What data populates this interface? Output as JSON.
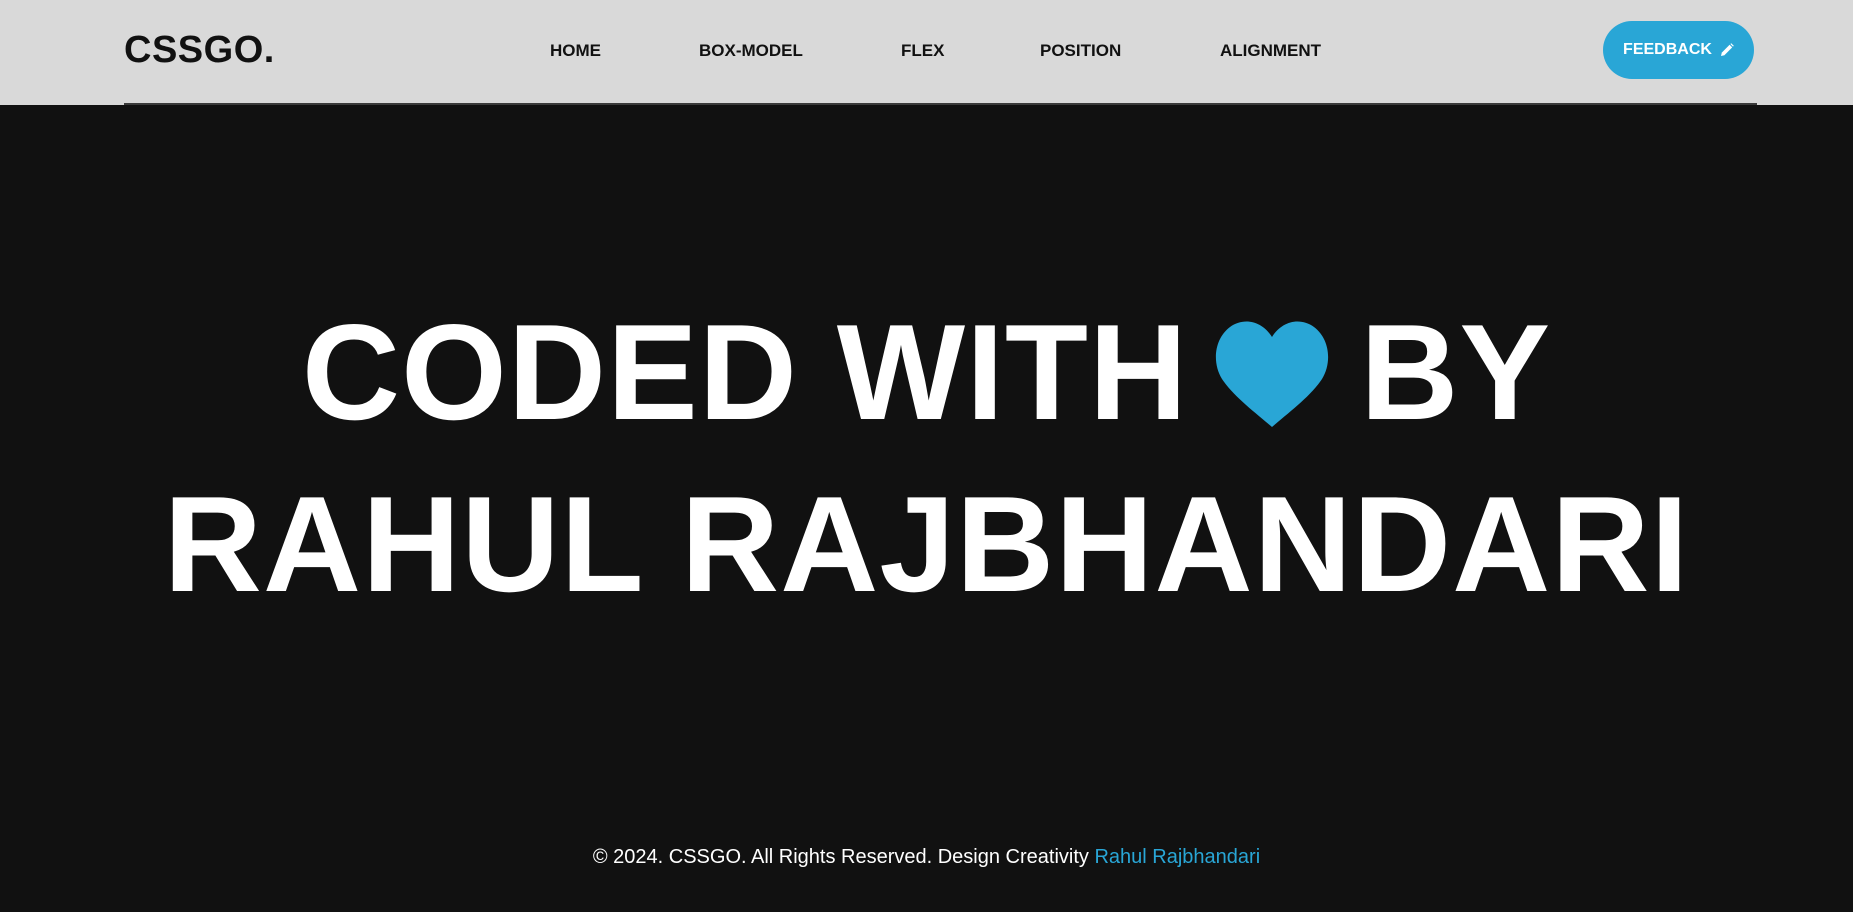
{
  "header": {
    "logo": "CSSGO.",
    "nav": [
      {
        "label": "HOME"
      },
      {
        "label": "BOX-MODEL"
      },
      {
        "label": "FLEX"
      },
      {
        "label": "POSITION"
      },
      {
        "label": "ALIGNMENT"
      }
    ],
    "feedback_label": "FEEDBACK",
    "feedback_icon": "pencil-icon"
  },
  "hero": {
    "line1_before": "CODED WITH",
    "heart_icon": "heart-icon",
    "line1_after": "BY",
    "line2": "RAHUL RAJBHANDARI"
  },
  "footer": {
    "text": "© 2024. CSSGO. All Rights Reserved. Design Creativity",
    "author": "Rahul Rajbhandari"
  },
  "colors": {
    "header_bg": "#d9d9d9",
    "page_bg": "#111111",
    "accent": "#29a6d6",
    "text_light": "#ffffff",
    "text_dark": "#111111"
  }
}
